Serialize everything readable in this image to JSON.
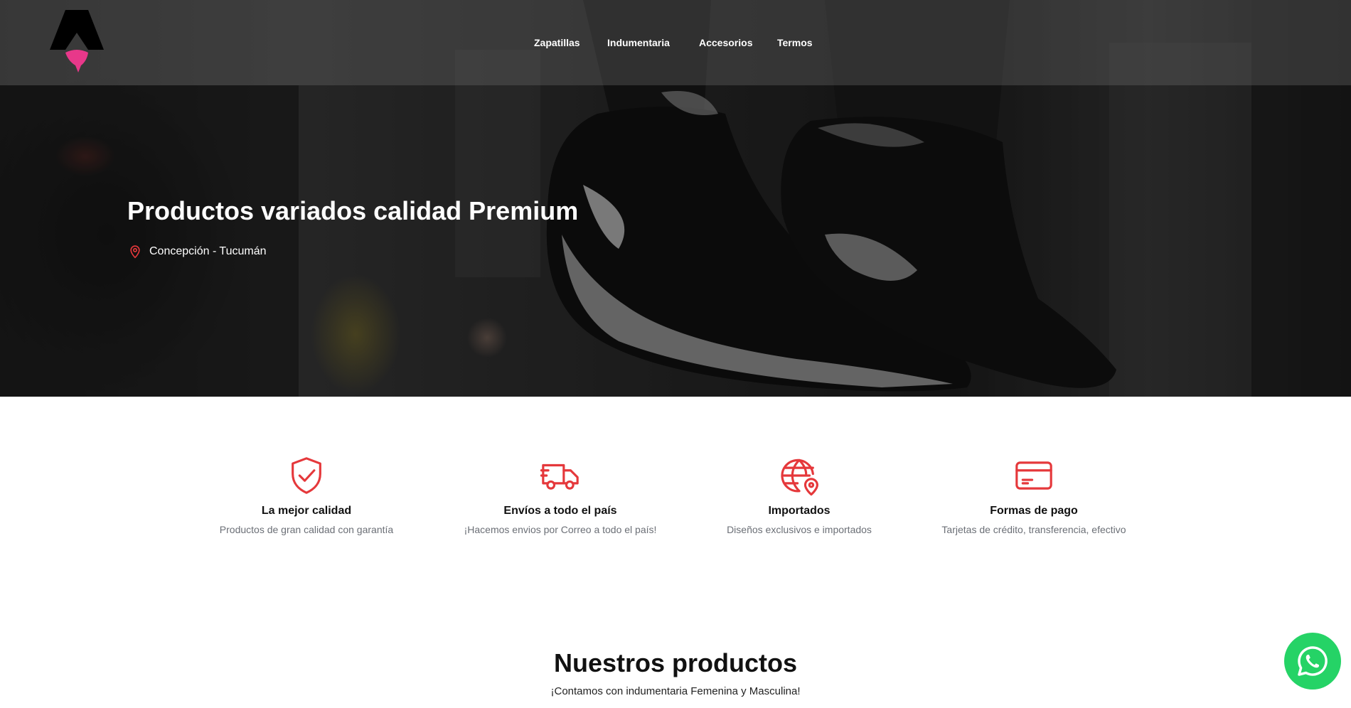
{
  "nav": {
    "items": [
      {
        "label": "Zapatillas"
      },
      {
        "label": "Indumentaria"
      },
      {
        "label": "Accesorios"
      },
      {
        "label": "Termos"
      }
    ]
  },
  "hero": {
    "title": "Productos variados calidad Premium",
    "location": "Concepción - Tucumán",
    "location_icon": "map-pin-icon"
  },
  "features": [
    {
      "icon": "shield-check-icon",
      "title": "La mejor calidad",
      "description": "Productos de gran calidad con garantía"
    },
    {
      "icon": "truck-icon",
      "title": "Envíos a todo el país",
      "description": "¡Hacemos envios por Correo a todo el país!"
    },
    {
      "icon": "globe-pin-icon",
      "title": "Importados",
      "description": "Diseños exclusivos e importados"
    },
    {
      "icon": "credit-card-icon",
      "title": "Formas de pago",
      "description": "Tarjetas de crédito, transferencia, efectivo"
    }
  ],
  "products": {
    "title": "Nuestros productos",
    "subtitle": "¡Contamos con indumentaria Femenina y Masculina!"
  },
  "whatsapp": {
    "icon": "whatsapp-icon"
  },
  "colors": {
    "accent": "#e5383b",
    "logo_pink": "#e8388a",
    "whatsapp": "#25d366",
    "muted_text": "#6b6f76"
  }
}
